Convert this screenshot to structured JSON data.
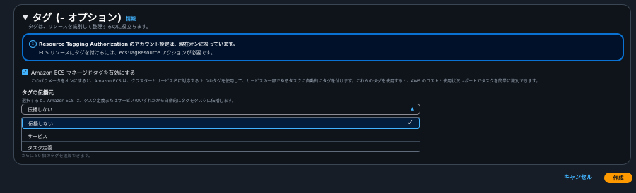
{
  "section": {
    "title": "タグ (- オプション)",
    "info_link": "情報",
    "description": "タグは、リソースを識別して整理するのに役立ちます。"
  },
  "alert": {
    "title": "Resource Tagging Authorization のアカウント設定は、現在オンになっています。",
    "body": "ECS リソースにタグを付けるには、ecs:TagResource アクションが必要です。"
  },
  "managed_tags": {
    "checked": true,
    "label": "Amazon ECS マネージドタグを有効にする",
    "description": "このパラメータをオンにすると、Amazon ECS は、クラスターとサービス名に対応する 2 つのタグを使用して、サービスの一部であるタスクに自動的にタグを付けます。これらのタグを使用すると、AWS のコストと使用状況レポートでタスクを簡単に識別できます。"
  },
  "propagate": {
    "label": "タグの伝播元",
    "description": "選択すると、Amazon ECS は、タスク定義またはサービスのいずれかから自動的にタグをタスクに伝播します。",
    "selected": "伝播しない",
    "options": [
      "伝播しない",
      "サービス",
      "タスク定義"
    ]
  },
  "hidden_hint": "さらに 50 個のタグを追加できます。",
  "footer": {
    "cancel_label": "キャンセル",
    "create_label": "作成"
  },
  "colors": {
    "accent": "#42b4ff",
    "primary_button": "#ff9900",
    "alert_border": "#0972d3"
  }
}
